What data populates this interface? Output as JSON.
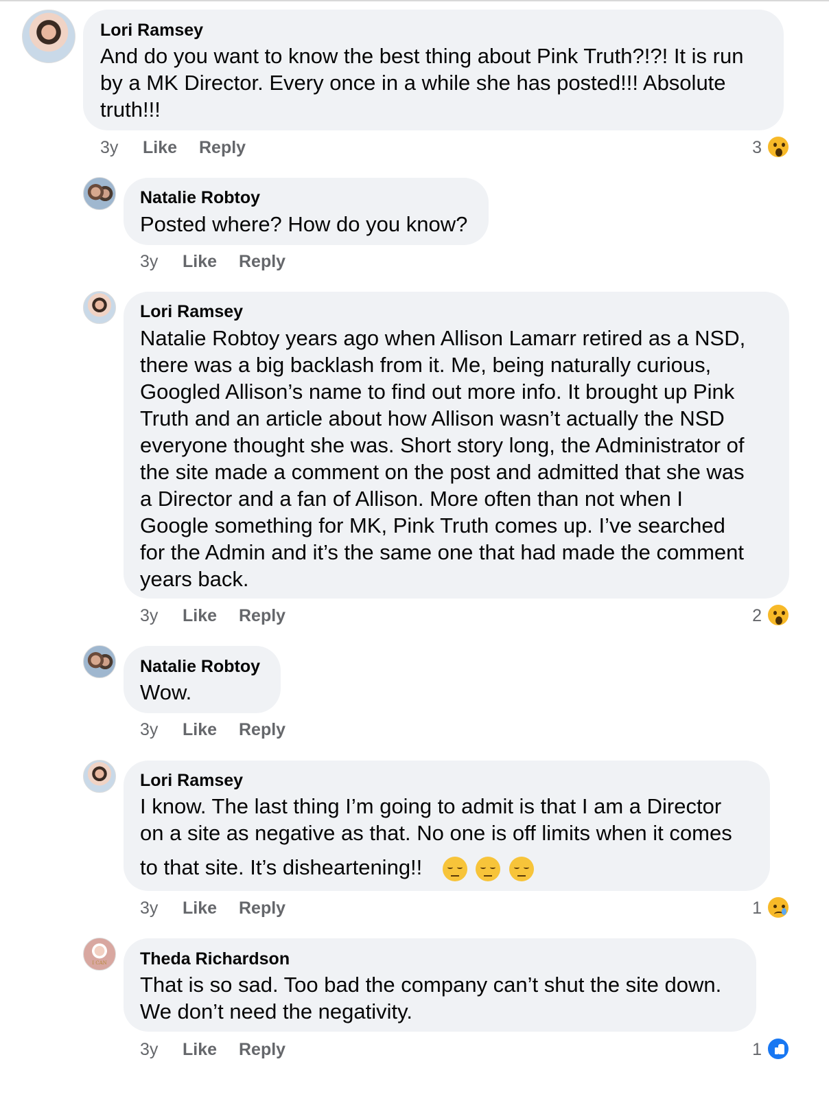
{
  "comments": [
    {
      "author": "Lori Ramsey",
      "lines": [
        "And do you want to know the best thing about Pink Truth?!?!  It is run",
        "by a MK Director.  Every once in a while she has posted!!!  Absolute",
        "truth!!!"
      ],
      "time": "3y",
      "like_label": "Like",
      "reply_label": "Reply",
      "reaction_count": "3",
      "reaction_icon": "wow-reaction-icon"
    },
    {
      "author": "Natalie Robtoy",
      "lines": [
        "Posted where? How do you know?"
      ],
      "time": "3y",
      "like_label": "Like",
      "reply_label": "Reply"
    },
    {
      "author": "Lori Ramsey",
      "lines": [
        "Natalie Robtoy years ago when Allison Lamarr retired as a NSD,",
        "there was a big backlash from it.  Me, being naturally curious,",
        "Googled Allison’s name to find out more info.  It brought up Pink",
        "Truth and an article about how Allison wasn’t actually the NSD",
        "everyone thought she was.  Short story long, the Administrator of",
        "the site made a comment on the post and admitted that she was",
        "a Director and a fan of Allison.  More often than not when I",
        "Google something for MK, Pink Truth comes up.  I’ve searched",
        "for the Admin and it’s the same one that had made the comment",
        "years back."
      ],
      "time": "3y",
      "like_label": "Like",
      "reply_label": "Reply",
      "reaction_count": "2",
      "reaction_icon": "wow-reaction-icon"
    },
    {
      "author": "Natalie Robtoy",
      "lines": [
        "Wow."
      ],
      "time": "3y",
      "like_label": "Like",
      "reply_label": "Reply"
    },
    {
      "author": "Lori Ramsey",
      "lines": [
        "I know.  The last thing I’m going to admit is that I am a Director",
        "on a site as negative as that.  No one is off limits when it comes",
        "to that site.  It’s disheartening!!"
      ],
      "emoji": [
        "pensive-face-icon",
        "pensive-face-icon",
        "pensive-face-icon"
      ],
      "time": "3y",
      "like_label": "Like",
      "reply_label": "Reply",
      "reaction_count": "1",
      "reaction_icon": "sad-reaction-icon"
    },
    {
      "author": "Theda Richardson",
      "lines": [
        "That is so sad. Too bad the company can’t shut the site down.",
        "We don’t need the negativity."
      ],
      "time": "3y",
      "like_label": "Like",
      "reply_label": "Reply",
      "reaction_count": "1",
      "reaction_icon": "like-reaction-icon"
    }
  ],
  "colors": {
    "bubble": "#f0f2f5",
    "meta_text": "#65676b",
    "wow": "#f7b928",
    "like_blue": "#1877f2"
  }
}
